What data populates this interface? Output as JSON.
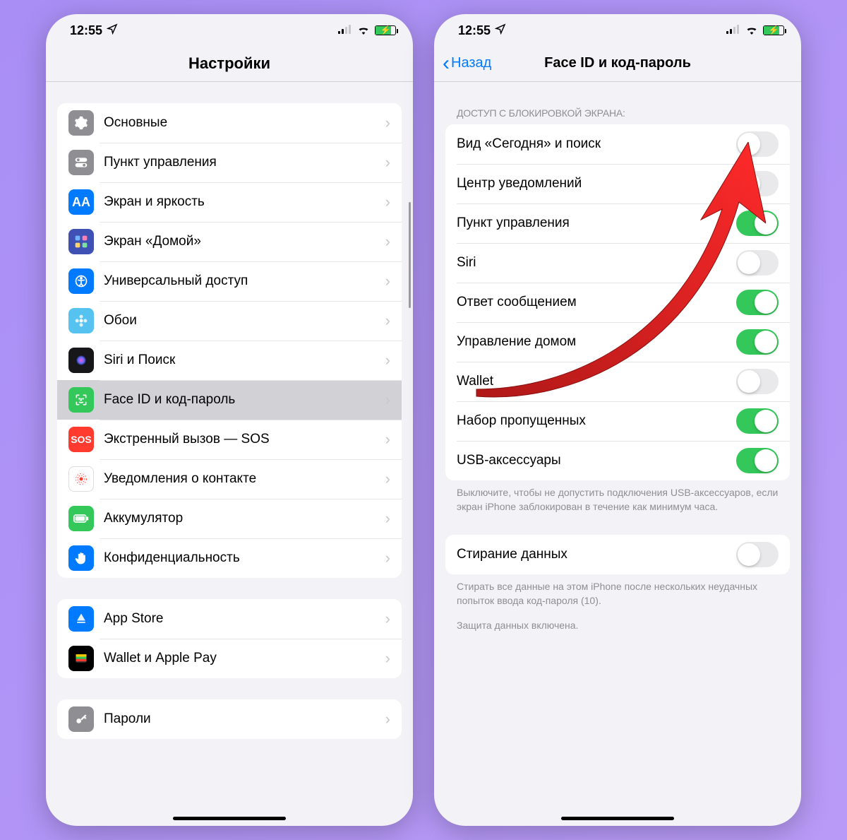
{
  "status": {
    "time": "12:55"
  },
  "left": {
    "title": "Настройки",
    "group1": [
      {
        "key": "general",
        "label": "Основные"
      },
      {
        "key": "control",
        "label": "Пункт управления"
      },
      {
        "key": "display",
        "label": "Экран и яркость"
      },
      {
        "key": "homescreen",
        "label": "Экран «Домой»"
      },
      {
        "key": "accessibility",
        "label": "Универсальный доступ"
      },
      {
        "key": "wallpaper",
        "label": "Обои"
      },
      {
        "key": "siri",
        "label": "Siri и Поиск"
      },
      {
        "key": "faceid",
        "label": "Face ID и код-пароль",
        "selected": true
      },
      {
        "key": "sos",
        "label": "Экстренный вызов — SOS"
      },
      {
        "key": "exposure",
        "label": "Уведомления о контакте"
      },
      {
        "key": "battery",
        "label": "Аккумулятор"
      },
      {
        "key": "privacy",
        "label": "Конфиденциальность"
      }
    ],
    "group2": [
      {
        "key": "appstore",
        "label": "App Store"
      },
      {
        "key": "wallet",
        "label": "Wallet и Apple Pay"
      }
    ],
    "group3_first_label": "Пароли"
  },
  "right": {
    "back": "Назад",
    "title": "Face ID и код-пароль",
    "section_header": "ДОСТУП С БЛОКИРОВКОЙ ЭКРАНА:",
    "toggles": [
      {
        "key": "today",
        "label": "Вид «Сегодня» и поиск",
        "on": false
      },
      {
        "key": "notif",
        "label": "Центр уведомлений",
        "on": false
      },
      {
        "key": "control",
        "label": "Пункт управления",
        "on": true
      },
      {
        "key": "siri",
        "label": "Siri",
        "on": false
      },
      {
        "key": "reply",
        "label": "Ответ сообщением",
        "on": true
      },
      {
        "key": "home",
        "label": "Управление домом",
        "on": true
      },
      {
        "key": "wallet",
        "label": "Wallet",
        "on": false
      },
      {
        "key": "missed",
        "label": "Набор пропущенных",
        "on": true
      },
      {
        "key": "usb",
        "label": "USB-аксессуары",
        "on": true
      }
    ],
    "usb_footer": "Выключите, чтобы не допустить подключения USB-аксессуаров, если экран iPhone заблокирован в течение как минимум часа.",
    "erase": {
      "label": "Стирание данных",
      "on": false
    },
    "erase_footer": "Стирать все данные на этом iPhone после нескольких неудачных попыток ввода код-пароля (10).",
    "protection": "Защита данных включена."
  }
}
